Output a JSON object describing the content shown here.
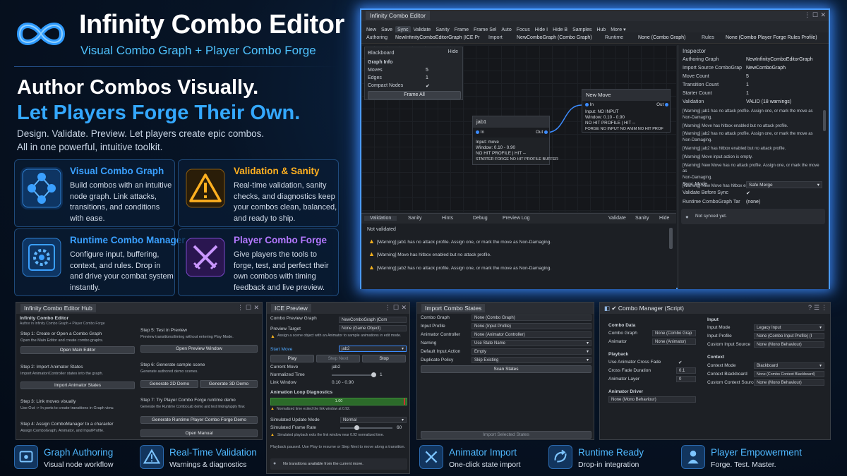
{
  "hero": {
    "title": "Infinity Combo Editor",
    "subtitle": "Visual Combo Graph + Player Combo Forge",
    "headline_1": "Author Combos Visually.",
    "headline_2": "Let Players Forge Their Own.",
    "tagline_1": "Design. Validate. Preview. Let players create epic combos.",
    "tagline_2": "All in one powerful, intuitive toolkit."
  },
  "cards": [
    {
      "title": "Visual Combo Graph",
      "desc": "Build combos with an intuitive node graph. Link attacks, transitions, and conditions with ease.",
      "icon": "graph-nodes-icon",
      "color": "#3aa0ff"
    },
    {
      "title": "Validation & Sanity",
      "desc": "Real-time validation, sanity checks, and diagnostics keep your combos clean, balanced, and ready to ship.",
      "icon": "warning-triangle-icon",
      "color": "#ffb020"
    },
    {
      "title": "Runtime Combo Manager",
      "desc": "Configure input, buffering, context, and rules. Drop in and drive your combat system instantly.",
      "icon": "gear-chip-icon",
      "color": "#3aa0ff"
    },
    {
      "title": "Player Combo Forge",
      "desc": "Give players the tools to forge, test, and perfect their own combos with timing feedback and live preview.",
      "icon": "crossed-swords-icon",
      "color": "#b478ff"
    }
  ],
  "editor": {
    "window_title": "Infinity Combo Editor",
    "toolbar": [
      "New",
      "Save",
      "Sync",
      "Validate",
      "Sanity",
      "Frame",
      "Frame Sel",
      "Auto",
      "Focus",
      "Hide I",
      "Hide B",
      "Samples",
      "Hub",
      "More ▾"
    ],
    "authoring_label": "Authoring",
    "authoring_value": "NewInfinityComboEditorGraph (ICE Pr",
    "import_label": "Import",
    "import_value": "NewComboGraph (Combo Graph)",
    "runtime_label": "Runtime",
    "runtime_value": "None (Combo Graph)",
    "rules_label": "Rules",
    "rules_value": "None (Combo Player Forge Rules Profile)",
    "blackboard": {
      "title": "Blackboard",
      "hide": "Hide",
      "section": "Graph Info",
      "rows": [
        {
          "k": "Moves",
          "v": "5"
        },
        {
          "k": "Edges",
          "v": "1"
        },
        {
          "k": "Compact Nodes",
          "v": "✔"
        }
      ],
      "frame_all": "Frame All"
    },
    "nodes": {
      "jab1": {
        "title": "jab1",
        "in": "In",
        "out": "Out",
        "lines": [
          "Input: move",
          "Window: 0.10 - 0.90",
          "NO HIT PROFILE | HIT --",
          "STARTER  FORGE  NO HIT PROFILE  BUFFER"
        ]
      },
      "newmove": {
        "title": "New Move",
        "in": "In",
        "out": "Out",
        "lines": [
          "Input: NO INPUT",
          "Window: 0.10 - 0.90",
          "NO HIT PROFILE | HIT --",
          "FORGE  NO INPUT  NO ANIM  NO HIT PROF"
        ]
      }
    },
    "bottom_tabs": [
      "Validation",
      "Sanity",
      "Hints",
      "Debug",
      "Preview Log"
    ],
    "bottom_actions": [
      "Validate",
      "Sanity",
      "Hide"
    ],
    "validation_status": "Not validated",
    "validation_warnings": [
      "[Warning] jab1 has no attack profile. Assign one, or mark the move as Non-Damaging.",
      "[Warning] Move has hitbox enabled but no attack profile.",
      "[Warning] jab2 has no attack profile. Assign one, or mark the move as Non-Damaging."
    ],
    "inspector": {
      "title": "Inspector",
      "rows": [
        {
          "k": "Authoring Graph",
          "v": "NewInfinityComboEditorGraph"
        },
        {
          "k": "Import Source ComboGrap",
          "v": "NewComboGraph"
        },
        {
          "k": "Move Count",
          "v": "5"
        },
        {
          "k": "Transition Count",
          "v": "1"
        },
        {
          "k": "Starter Count",
          "v": "1"
        },
        {
          "k": "Validation",
          "v": "VALID (18 warnings)"
        }
      ],
      "warnings": [
        "[Warning] jab1 has no attack profile. Assign one, or mark the move as",
        "Non-Damaging.",
        "[Warning] Move has hitbox enabled but no attack profile.",
        "[Warning] jab2 has no attack profile. Assign one, or mark the move as",
        "Non-Damaging.",
        "[Warning] jab2 has hitbox enabled but no attack profile.",
        "[Warning] Move input action is empty.",
        "[Warning] New Move has no attack profile. Assign one, or mark the move as",
        "Non-Damaging.",
        "[Warning] New Move has hitbox enabled but no attack profile."
      ],
      "sync_mode_label": "Sync Mode",
      "sync_mode_value": "Safe Merge",
      "validate_before_sync_label": "Validate Before Sync",
      "validate_before_sync_value": "✔",
      "runtime_target_label": "Runtime ComboGraph Tar",
      "runtime_target_value": "(none)",
      "sync_status": "Not synced yet."
    }
  },
  "hub": {
    "title": "Infinity Combo Editor Hub",
    "heading": "Infinity Combo Editor",
    "sub": "Author in Infinity Combo Graph + Player Combo Forge",
    "steps": [
      {
        "title": "Step 1: Create or Open a Combo Graph",
        "desc": "Open the Main Editor and create combo graphs.",
        "btn": "Open Main Editor"
      },
      {
        "title": "Step 2: Import Animator States",
        "desc": "Import Animator/Controller states into the graph.",
        "btn": "Import Animator States"
      },
      {
        "title": "Step 3: Link moves visually",
        "desc": "Use Out -> In ports to create transitions in Graph view."
      },
      {
        "title": "Step 4: Assign ComboManager to a character",
        "desc": "Assign ComboGraph, Animator, and InputProfile."
      },
      {
        "title": "Step 5: Test in Preview",
        "desc": "Preview transitions/timing without entering Play Mode.",
        "btn": "Open Preview Window"
      },
      {
        "title": "Step 6: Generate sample scene",
        "desc": "Generate authored demo scenes.",
        "btn_a": "Generate 2D Demo",
        "btn_b": "Generate 3D Demo"
      },
      {
        "title": "Step 7: Try Player Combo Forge runtime demo",
        "desc": "Generate the Runtime ComboLab demo and test linking/apply flow.",
        "btn": "Generate Runtime Player Combo Forge Demo"
      },
      {
        "btn": "Open Manual"
      }
    ]
  },
  "preview": {
    "title": "ICE Preview",
    "rows": [
      {
        "k": "Combo Preview Graph",
        "v": "NewComboGraph (Com"
      },
      {
        "k": "Preview Target",
        "v": "None (Game Object)"
      }
    ],
    "info": "Assign a scene object with an Animator to sample animations in edit mode.",
    "start_move_label": "Start Move",
    "start_move_value": "jab2",
    "play": "Play",
    "step_next": "Step Next",
    "stop": "Stop",
    "current_move_label": "Current Move",
    "current_move_value": "jab2",
    "normalized_time_label": "Normalized Time",
    "normalized_time_value": "1",
    "link_window_label": "Link Window",
    "link_window_value": "0.10 - 0.90",
    "loop_title": "Animation Loop Diagnostics",
    "loop_value": "1.00",
    "loop_warn": "Normalized time exited the link window at 0.92.",
    "sim_update_label": "Simulated Update Mode",
    "sim_update_value": "Normal",
    "sim_fps_label": "Simulated Frame Rate",
    "sim_fps_value": "60",
    "sim_warn": "Simulated playback exits the link window near 0.92 normalized time.",
    "paused_note": "Playback paused. Use Play to resume or Step Next to move along a transition.",
    "no_transitions": "No transitions available from the current move."
  },
  "import": {
    "title": "Import Combo States",
    "rows": [
      {
        "k": "Combo Graph",
        "v": "None (Combo Graph)"
      },
      {
        "k": "Input Profile",
        "v": "None (Input Profile)"
      },
      {
        "k": "Animator Controller",
        "v": "None (Animator Controller)"
      },
      {
        "k": "Naming",
        "v": "Use State Name"
      },
      {
        "k": "Default Input Action",
        "v": "Empty"
      },
      {
        "k": "Duplicate Policy",
        "v": "Skip Existing"
      }
    ],
    "scan": "Scan States",
    "import_selected": "Import Selected States"
  },
  "manager": {
    "title": "✔ Combo Manager (Script)",
    "combo_data": "Combo Data",
    "combo_graph_label": "Combo Graph",
    "combo_graph_value": "None (Combo Grap",
    "animator_label": "Animator",
    "animator_value": "None (Animator)",
    "playback": "Playback",
    "cross_fade_label": "Use Animator Cross Fade",
    "cross_fade_value": "✔",
    "cross_fade_dur_label": "Cross Fade Duration",
    "cross_fade_dur_value": "0.1",
    "anim_layer_label": "Animator Layer",
    "anim_layer_value": "0",
    "animator_driver": "Animator Driver",
    "driver_value": "None (Mono Behaviour)",
    "input": "Input",
    "input_mode_label": "Input Mode",
    "input_mode_value": "Legacy Input",
    "input_profile_label": "Input Profile",
    "input_profile_value": "None (Combo Input Profile) (I",
    "custom_input_label": "Custom Input Source",
    "custom_input_value": "None (Mono Behaviour)",
    "context": "Context",
    "context_mode_label": "Context Mode",
    "context_mode_value": "Blackboard",
    "context_bb_label": "Context Blackboard",
    "context_bb_value": "None (Combo Context Blackboard)",
    "custom_ctx_label": "Custom Context Source",
    "custom_ctx_value": "None (Mono Behaviour)"
  },
  "features": [
    {
      "title": "Graph Authoring",
      "sub": "Visual node workflow",
      "icon": "graph-editor-icon"
    },
    {
      "title": "Real-Time Validation",
      "sub": "Warnings & diagnostics",
      "icon": "warning-icon"
    },
    {
      "title": "Animator Import",
      "sub": "One-click state import",
      "icon": "import-swords-icon"
    },
    {
      "title": "Runtime Ready",
      "sub": "Drop-in integration",
      "icon": "runtime-arrows-icon"
    },
    {
      "title": "Player Empowerment",
      "sub": "Forge. Test. Master.",
      "icon": "player-icon"
    }
  ],
  "colors": {
    "accent": "#34a8ff",
    "warning": "#ffb020",
    "purple": "#b478ff",
    "glow": "#3d8bff"
  }
}
